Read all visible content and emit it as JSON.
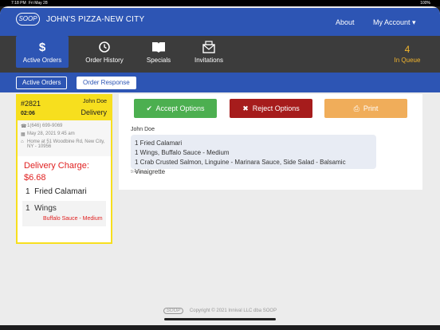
{
  "status": {
    "time": "7:18 PM",
    "date": "Fri May 28",
    "battery": "100%"
  },
  "navbar": {
    "logo": "SOOP",
    "title": "JOHN'S PIZZA-NEW CITY",
    "about": "About",
    "account": "My Account ▾"
  },
  "tabs": [
    {
      "label": "Active Orders",
      "icon": "dollar-icon",
      "glyph": "$"
    },
    {
      "label": "Order History",
      "icon": "history-icon",
      "glyph": "⟲"
    },
    {
      "label": "Specials",
      "icon": "book-icon",
      "glyph": "▮"
    },
    {
      "label": "Invitations",
      "icon": "envelope-icon",
      "glyph": "✉"
    }
  ],
  "queue": {
    "count": "4",
    "label": "In Queue"
  },
  "subtabs": {
    "active_orders": "Active Orders",
    "order_response": "Order Response"
  },
  "order": {
    "number": "#2821",
    "customer": "John Doe",
    "time": "02:06",
    "type": "Delivery",
    "phone": "1(646) 699-9069",
    "datetime": "May 28, 2021 9:45 am",
    "address": "Home at 51 Woodbine Rd, New City, NY - 10956",
    "delivery_charge": "Delivery Charge: $6.68",
    "items": [
      {
        "qty": "1",
        "name": "Fried Calamari"
      },
      {
        "qty": "1",
        "name": "Wings",
        "modifier": "Buffalo Sauce - Medium"
      }
    ]
  },
  "detail": {
    "accept_label": "Accept Options",
    "reject_label": "Reject Options",
    "print_label": "Print",
    "customer": "John Doe",
    "lines": [
      "1 Fried Calamari",
      "1 Wings, Buffalo Sauce - Medium",
      "1 Crab Crusted Salmon, Linguine - Marinara Sauce, Side Salad - Balsamic Vinaigrette"
    ],
    "timestamp": "9:45 am"
  },
  "footer": {
    "logo": "SOOP",
    "copyright": "Copyright © 2021 Innival LLC dba SOOP"
  },
  "colors": {
    "primary": "#2d55b4",
    "accept": "#4caf50",
    "reject": "#a61c1c",
    "print": "#f0ad5a",
    "highlight": "#f7df1e",
    "alert": "#e02020"
  }
}
